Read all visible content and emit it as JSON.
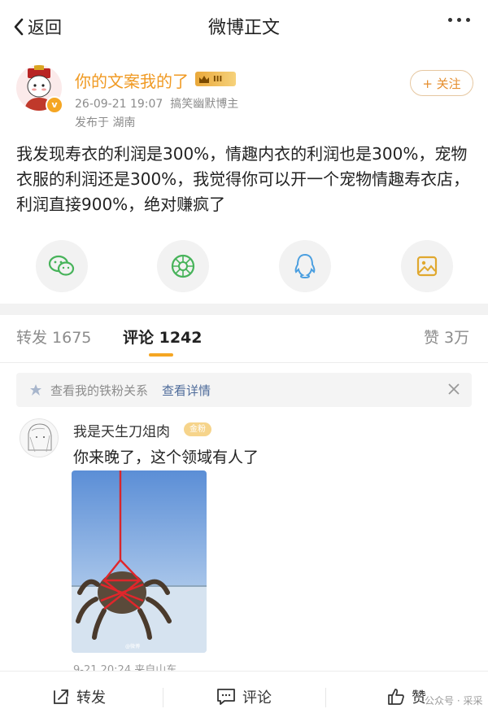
{
  "nav": {
    "back_label": "返回",
    "title": "微博正文",
    "more_icon": "more-dots-icon"
  },
  "post": {
    "author": "你的文案我的了",
    "level_badge": "III",
    "timestamp": "26-09-21 19:07",
    "source": "搞笑幽默博主",
    "location": "发布于 湖南",
    "follow_label": "+ 关注",
    "content": "我发现寿衣的利润是300%，情趣内衣的利润也是300%，宠物衣服的利润还是300%，我觉得你可以开一个宠物情趣寿衣店，利润直接900%，绝对赚疯了"
  },
  "share": [
    {
      "name": "wechat-icon",
      "color": "#47b35a"
    },
    {
      "name": "moments-icon",
      "color": "#47b35a"
    },
    {
      "name": "qq-icon",
      "color": "#4b9fe0"
    },
    {
      "name": "save-image-icon",
      "color": "#e0a82e"
    }
  ],
  "tabs": {
    "repost": "转发 1675",
    "comment": "评论 1242",
    "like": "赞 3万"
  },
  "fan_notice": {
    "text": "查看我的铁粉关系",
    "link": "查看详情"
  },
  "comment": {
    "user": "我是天生刀俎肉",
    "badge": "金粉",
    "text": "你来晚了，这个领域有人了",
    "meta": "9-21 20:24 来自山东"
  },
  "bottom_bar": {
    "repost": "转发",
    "comment": "评论",
    "like": "赞"
  },
  "watermark": "公众号 · 采采",
  "colors": {
    "accent": "#f5a623",
    "author": "#f09a23",
    "link": "#4e6b9a"
  }
}
